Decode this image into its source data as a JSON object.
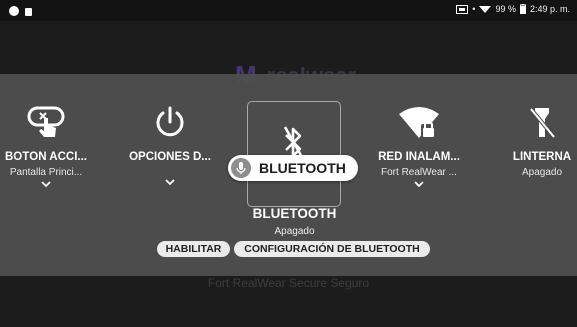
{
  "status_bar": {
    "battery_text": "99 %",
    "time": "2:49 p. m."
  },
  "background": {
    "logo_text": "realwear",
    "caption": "Fort RealWear Secure Seguro"
  },
  "tiles": [
    {
      "title": "BOTÓN ACCI...",
      "subtitle": "Pantalla Princi...",
      "icon": "hand-pointer-icon",
      "has_chevron": true
    },
    {
      "title": "OPCIONES D...",
      "subtitle": "",
      "icon": "power-icon",
      "has_chevron": true
    },
    {
      "title": "",
      "subtitle": "",
      "icon": "bluetooth-icon",
      "has_chevron": false,
      "selected": true
    },
    {
      "title": "RED INALÁM...",
      "subtitle": "Fort RealWear ...",
      "icon": "wifi-lock-icon",
      "has_chevron": true
    },
    {
      "title": "LINTERNA",
      "subtitle": "Apagado",
      "icon": "flashlight-off-icon",
      "has_chevron": false
    }
  ],
  "voice_hint": "BLUETOOTH",
  "detail": {
    "title": "BLUETOOTH",
    "status": "Apagado",
    "actions": [
      "HABILITAR",
      "CONFIGURACIÓN DE BLUETOOTH"
    ]
  },
  "colors": {
    "panel": "#4e4e4e",
    "background": "#1c1c1c",
    "pill": "#ebebeb",
    "accent_logo": "#4b3b7a"
  }
}
